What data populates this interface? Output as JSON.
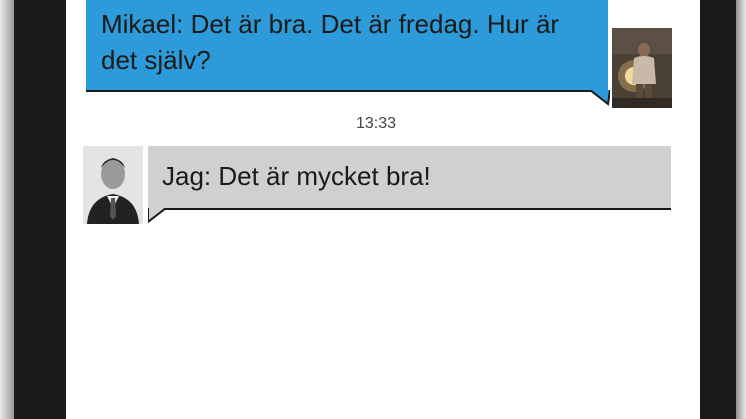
{
  "conversation": {
    "messages": [
      {
        "text": "Mikael: Det är bra. Det är fredag. Hur är det själv?",
        "bubble_color": "#2d9ad9",
        "avatar": "person-avatar-mikael"
      },
      {
        "text": "Jag: Det är mycket bra!",
        "bubble_color": "#d0d0d0",
        "avatar": "person-avatar-jag"
      }
    ],
    "timestamp": "13:33"
  },
  "colors": {
    "incoming_bubble": "#2d9ad9",
    "outgoing_bubble": "#d0d0d0",
    "text": "#1a1a1a",
    "phone_bezel": "#1b1b1b"
  }
}
